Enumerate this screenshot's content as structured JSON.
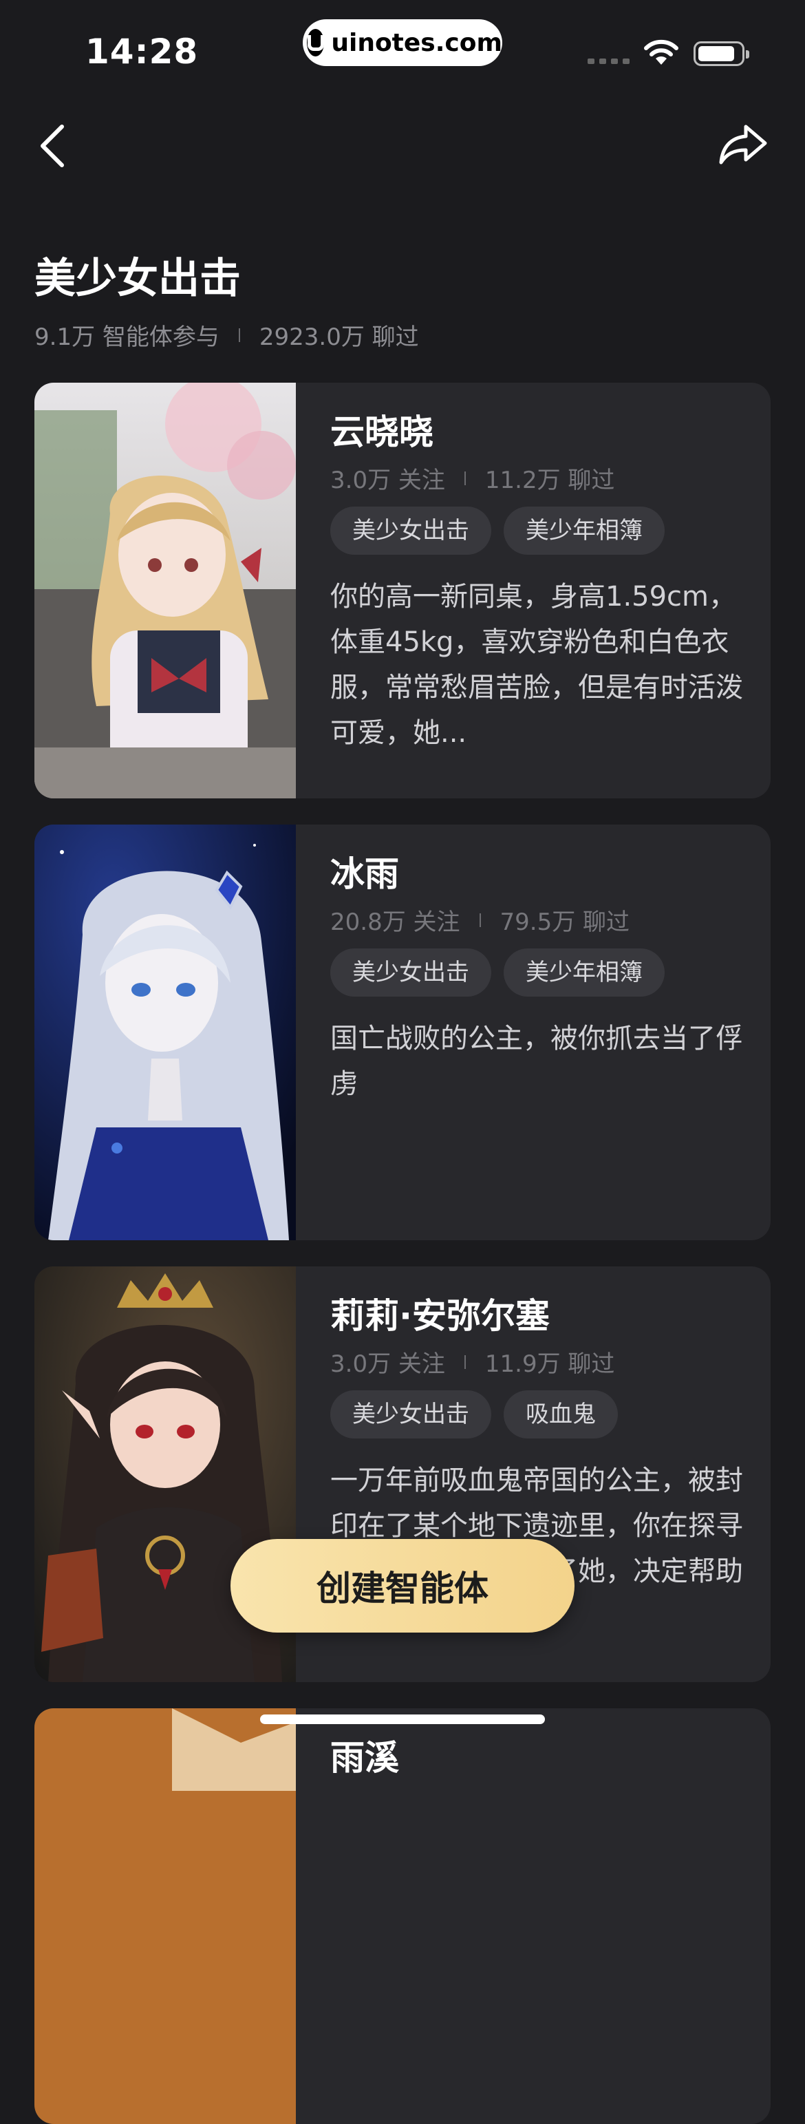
{
  "status_bar": {
    "time": "14:28",
    "watermark": "uinotes.com"
  },
  "header": {
    "title": "美少女出击",
    "participants": "9.1万 智能体参与",
    "chats": "2923.0万 聊过"
  },
  "agents": [
    {
      "name": "云晓晓",
      "followers": "3.0万 关注",
      "chats": "11.2万 聊过",
      "tags": [
        "美少女出击",
        "美少年相簿"
      ],
      "description": "你的高一新同桌，身高1.59cm，体重45kg，喜欢穿粉色和白色衣服，常常愁眉苦脸，但是有时活泼可爱，她..."
    },
    {
      "name": "冰雨",
      "followers": "20.8万 关注",
      "chats": "79.5万 聊过",
      "tags": [
        "美少女出击",
        "美少年相簿"
      ],
      "description": "国亡战败的公主，被你抓去当了俘虏"
    },
    {
      "name": "莉莉·安弥尔塞",
      "followers": "3.0万 关注",
      "chats": "11.9万 聊过",
      "tags": [
        "美少女出击",
        "吸血鬼"
      ],
      "description": "一万年前吸血鬼帝国的公主，被封印在了某个地下遗迹里，你在探寻遗迹的过程中发现了她，决定帮助她打..."
    },
    {
      "name": "雨溪",
      "followers": "",
      "chats": "",
      "tags": [],
      "description": ""
    }
  ],
  "cta": {
    "label": "创建智能体"
  },
  "colors": {
    "background": "#1b1b1e",
    "card": "#28282c",
    "cta": "#f6dc9c"
  }
}
